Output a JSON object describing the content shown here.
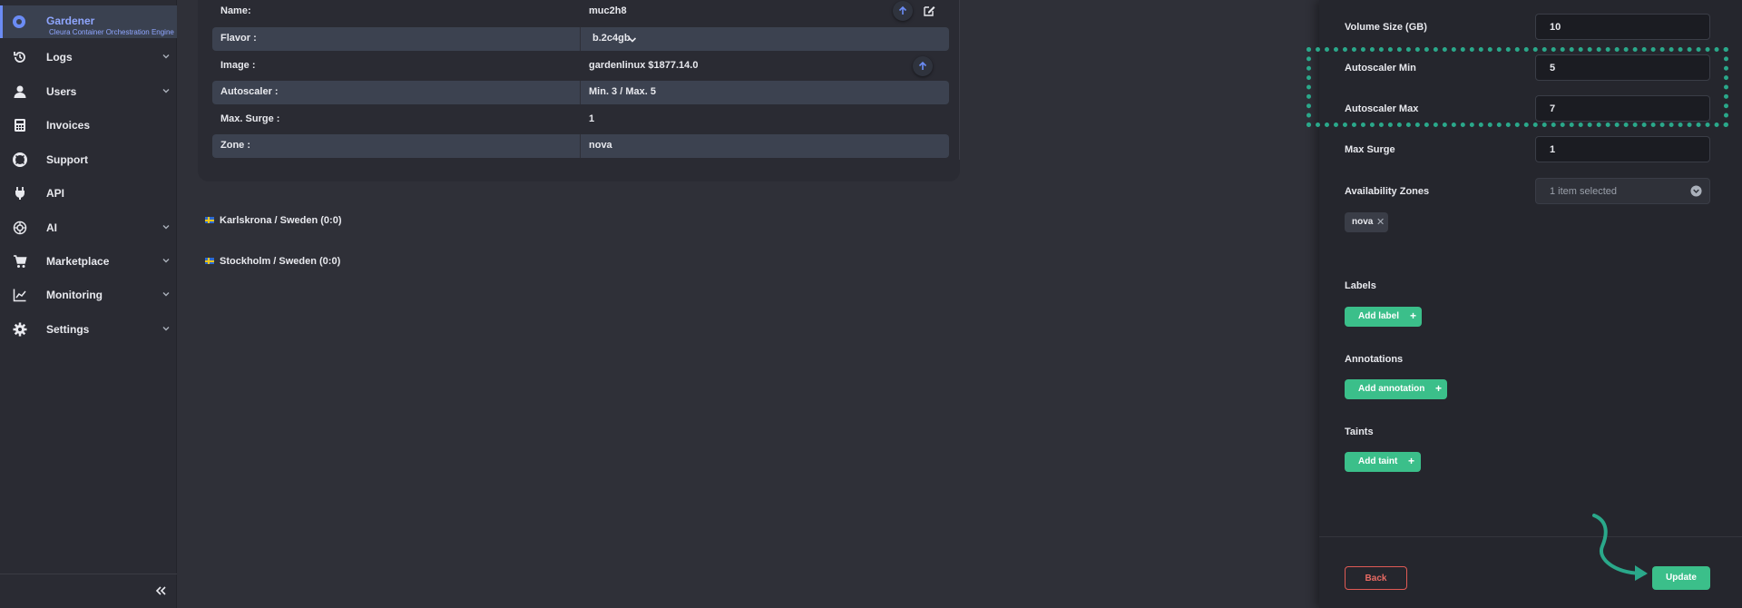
{
  "sidebar": {
    "brand": {
      "title": "Gardener",
      "subtitle": "Cleura Container Orchestration Engine"
    },
    "items": [
      {
        "label": "Logs",
        "icon": "history-icon",
        "expandable": true
      },
      {
        "label": "Users",
        "icon": "user-icon",
        "expandable": true
      },
      {
        "label": "Invoices",
        "icon": "calculator-icon",
        "expandable": false
      },
      {
        "label": "Support",
        "icon": "lifebuoy-icon",
        "expandable": false
      },
      {
        "label": "API",
        "icon": "plug-icon",
        "expandable": false
      },
      {
        "label": "AI",
        "icon": "ai-icon",
        "expandable": true
      },
      {
        "label": "Marketplace",
        "icon": "cart-icon",
        "expandable": true
      },
      {
        "label": "Monitoring",
        "icon": "chart-line-icon",
        "expandable": true
      },
      {
        "label": "Settings",
        "icon": "gear-icon",
        "expandable": true
      }
    ],
    "collapse_icon": "double-chevron-left-icon"
  },
  "details": {
    "rows": [
      {
        "label": "Name:",
        "value": "muc2h8"
      },
      {
        "label": "Flavor :",
        "value": "b.2c4gb"
      },
      {
        "label": "Image :",
        "value": "gardenlinux $1877.14.0"
      },
      {
        "label": "Autoscaler :",
        "value": "Min. 3 / Max. 5"
      },
      {
        "label": "Max. Surge :",
        "value": "1"
      },
      {
        "label": "Zone :",
        "value": "nova"
      }
    ]
  },
  "regions": [
    {
      "label": "Karlskrona / Sweden (0:0)"
    },
    {
      "label": "Stockholm / Sweden (0:0)"
    }
  ],
  "form": {
    "volume_size": {
      "label": "Volume Size (GB)",
      "value": "10"
    },
    "autoscaler_min": {
      "label": "Autoscaler Min",
      "value": "5"
    },
    "autoscaler_max": {
      "label": "Autoscaler Max",
      "value": "7"
    },
    "max_surge": {
      "label": "Max Surge",
      "value": "1"
    },
    "availability_zones": {
      "label": "Availability Zones",
      "selected_text": "1 item selected",
      "chips": [
        "nova"
      ]
    },
    "labels": {
      "title": "Labels",
      "button": "Add label"
    },
    "annotations": {
      "title": "Annotations",
      "button": "Add annotation"
    },
    "taints": {
      "title": "Taints",
      "button": "Add taint"
    },
    "back_button": "Back",
    "update_button": "Update"
  },
  "colors": {
    "accent": "#3bbf8a",
    "brand": "#8fa6ff",
    "danger": "#e05a55",
    "highlight": "#2aa88a"
  }
}
